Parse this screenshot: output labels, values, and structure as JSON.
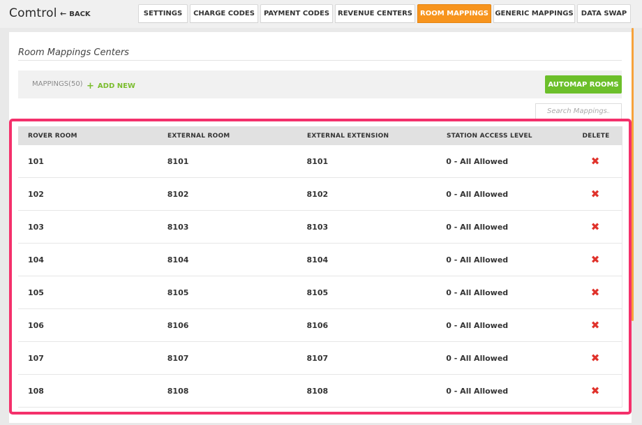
{
  "app": {
    "title": "Comtrol",
    "back_label": "BACK"
  },
  "tabs": [
    {
      "label": "SETTINGS",
      "active": false
    },
    {
      "label": "CHARGE CODES",
      "active": false
    },
    {
      "label": "PAYMENT CODES",
      "active": false
    },
    {
      "label": "REVENUE CENTERS",
      "active": false
    },
    {
      "label": "ROOM MAPPINGS",
      "active": true
    },
    {
      "label": "GENERIC MAPPINGS",
      "active": false
    },
    {
      "label": "DATA SWAP",
      "active": false
    }
  ],
  "page": {
    "title": "Room Mappings Centers"
  },
  "toolbar": {
    "mappings_count": "MAPPINGS(50)",
    "add_new_label": "ADD NEW",
    "automap_label": "AUTOMAP ROOMS"
  },
  "search": {
    "placeholder": "Search Mappings..."
  },
  "table": {
    "headers": [
      "ROVER ROOM",
      "EXTERNAL ROOM",
      "EXTERNAL EXTENSION",
      "STATION ACCESS LEVEL",
      "DELETE"
    ],
    "rows": [
      [
        "101",
        "8101",
        "8101",
        "0 - All Allowed"
      ],
      [
        "102",
        "8102",
        "8102",
        "0 - All Allowed"
      ],
      [
        "103",
        "8103",
        "8103",
        "0 - All Allowed"
      ],
      [
        "104",
        "8104",
        "8104",
        "0 - All Allowed"
      ],
      [
        "105",
        "8105",
        "8105",
        "0 - All Allowed"
      ],
      [
        "106",
        "8106",
        "8106",
        "0 - All Allowed"
      ],
      [
        "107",
        "8107",
        "8107",
        "0 - All Allowed"
      ],
      [
        "108",
        "8108",
        "8108",
        "0 - All Allowed"
      ]
    ],
    "delete_icon": "close-x-icon"
  },
  "colors": {
    "accent_active_tab": "#f7941d",
    "automap_button": "#6cbf2a",
    "add_new": "#7bbd2e",
    "delete": "#e0322b",
    "highlight_frame": "#f4306b"
  }
}
